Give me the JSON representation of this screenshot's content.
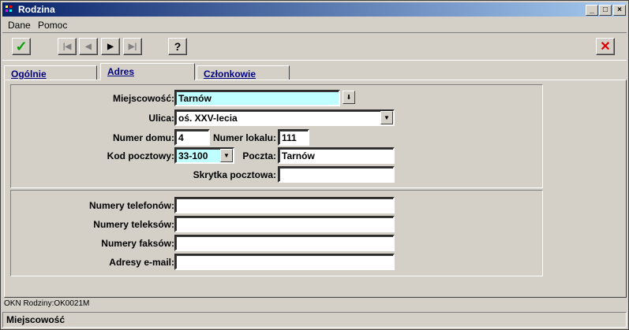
{
  "window": {
    "title": "Rodzina"
  },
  "menu": {
    "items": [
      "Dane",
      "Pomoc"
    ]
  },
  "toolbar": {
    "help_label": "?"
  },
  "tabs": [
    {
      "label": "Ogólnie"
    },
    {
      "label": "Adres"
    },
    {
      "label": "Członkowie"
    }
  ],
  "address": {
    "city_label": "Miejscowość:",
    "city_value": "Tarnów",
    "street_label": "Ulica:",
    "street_value": "oś. XXV-lecia",
    "house_label": "Numer domu:",
    "house_value": "4",
    "apt_label": "Numer lokalu:",
    "apt_value": "111",
    "postal_label": "Kod pocztowy:",
    "postal_value": "33-100",
    "post_label": "Poczta:",
    "post_value": "Tarnów",
    "pobox_label": "Skrytka pocztowa:",
    "pobox_value": ""
  },
  "contact": {
    "phones_label": "Numery telefonów:",
    "phones_value": "",
    "telex_label": "Numery teleksów:",
    "telex_value": "",
    "fax_label": "Numery faksów:",
    "fax_value": "",
    "email_label": "Adresy e-mail:",
    "email_value": ""
  },
  "status": {
    "record": "OKN Rodziny:OK0021M",
    "field_hint": "Miejscowość"
  }
}
